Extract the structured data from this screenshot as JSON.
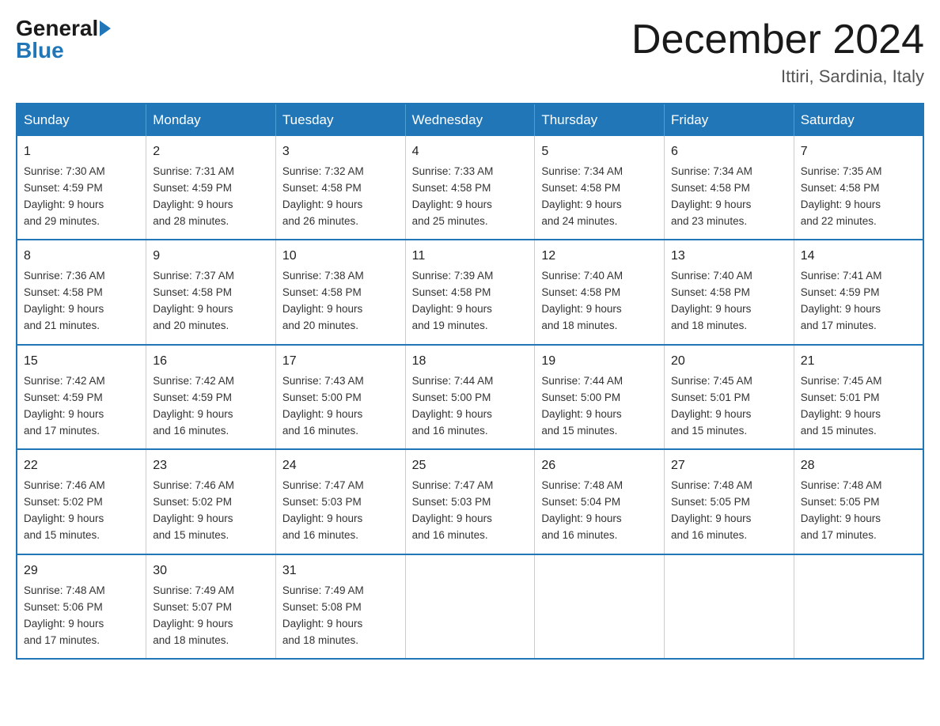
{
  "header": {
    "logo_general": "General",
    "logo_blue": "Blue",
    "month_year": "December 2024",
    "location": "Ittiri, Sardinia, Italy"
  },
  "days_of_week": [
    "Sunday",
    "Monday",
    "Tuesday",
    "Wednesday",
    "Thursday",
    "Friday",
    "Saturday"
  ],
  "weeks": [
    [
      {
        "day": "1",
        "sunrise": "7:30 AM",
        "sunset": "4:59 PM",
        "daylight": "9 hours and 29 minutes."
      },
      {
        "day": "2",
        "sunrise": "7:31 AM",
        "sunset": "4:59 PM",
        "daylight": "9 hours and 28 minutes."
      },
      {
        "day": "3",
        "sunrise": "7:32 AM",
        "sunset": "4:58 PM",
        "daylight": "9 hours and 26 minutes."
      },
      {
        "day": "4",
        "sunrise": "7:33 AM",
        "sunset": "4:58 PM",
        "daylight": "9 hours and 25 minutes."
      },
      {
        "day": "5",
        "sunrise": "7:34 AM",
        "sunset": "4:58 PM",
        "daylight": "9 hours and 24 minutes."
      },
      {
        "day": "6",
        "sunrise": "7:34 AM",
        "sunset": "4:58 PM",
        "daylight": "9 hours and 23 minutes."
      },
      {
        "day": "7",
        "sunrise": "7:35 AM",
        "sunset": "4:58 PM",
        "daylight": "9 hours and 22 minutes."
      }
    ],
    [
      {
        "day": "8",
        "sunrise": "7:36 AM",
        "sunset": "4:58 PM",
        "daylight": "9 hours and 21 minutes."
      },
      {
        "day": "9",
        "sunrise": "7:37 AM",
        "sunset": "4:58 PM",
        "daylight": "9 hours and 20 minutes."
      },
      {
        "day": "10",
        "sunrise": "7:38 AM",
        "sunset": "4:58 PM",
        "daylight": "9 hours and 20 minutes."
      },
      {
        "day": "11",
        "sunrise": "7:39 AM",
        "sunset": "4:58 PM",
        "daylight": "9 hours and 19 minutes."
      },
      {
        "day": "12",
        "sunrise": "7:40 AM",
        "sunset": "4:58 PM",
        "daylight": "9 hours and 18 minutes."
      },
      {
        "day": "13",
        "sunrise": "7:40 AM",
        "sunset": "4:58 PM",
        "daylight": "9 hours and 18 minutes."
      },
      {
        "day": "14",
        "sunrise": "7:41 AM",
        "sunset": "4:59 PM",
        "daylight": "9 hours and 17 minutes."
      }
    ],
    [
      {
        "day": "15",
        "sunrise": "7:42 AM",
        "sunset": "4:59 PM",
        "daylight": "9 hours and 17 minutes."
      },
      {
        "day": "16",
        "sunrise": "7:42 AM",
        "sunset": "4:59 PM",
        "daylight": "9 hours and 16 minutes."
      },
      {
        "day": "17",
        "sunrise": "7:43 AM",
        "sunset": "5:00 PM",
        "daylight": "9 hours and 16 minutes."
      },
      {
        "day": "18",
        "sunrise": "7:44 AM",
        "sunset": "5:00 PM",
        "daylight": "9 hours and 16 minutes."
      },
      {
        "day": "19",
        "sunrise": "7:44 AM",
        "sunset": "5:00 PM",
        "daylight": "9 hours and 15 minutes."
      },
      {
        "day": "20",
        "sunrise": "7:45 AM",
        "sunset": "5:01 PM",
        "daylight": "9 hours and 15 minutes."
      },
      {
        "day": "21",
        "sunrise": "7:45 AM",
        "sunset": "5:01 PM",
        "daylight": "9 hours and 15 minutes."
      }
    ],
    [
      {
        "day": "22",
        "sunrise": "7:46 AM",
        "sunset": "5:02 PM",
        "daylight": "9 hours and 15 minutes."
      },
      {
        "day": "23",
        "sunrise": "7:46 AM",
        "sunset": "5:02 PM",
        "daylight": "9 hours and 15 minutes."
      },
      {
        "day": "24",
        "sunrise": "7:47 AM",
        "sunset": "5:03 PM",
        "daylight": "9 hours and 16 minutes."
      },
      {
        "day": "25",
        "sunrise": "7:47 AM",
        "sunset": "5:03 PM",
        "daylight": "9 hours and 16 minutes."
      },
      {
        "day": "26",
        "sunrise": "7:48 AM",
        "sunset": "5:04 PM",
        "daylight": "9 hours and 16 minutes."
      },
      {
        "day": "27",
        "sunrise": "7:48 AM",
        "sunset": "5:05 PM",
        "daylight": "9 hours and 16 minutes."
      },
      {
        "day": "28",
        "sunrise": "7:48 AM",
        "sunset": "5:05 PM",
        "daylight": "9 hours and 17 minutes."
      }
    ],
    [
      {
        "day": "29",
        "sunrise": "7:48 AM",
        "sunset": "5:06 PM",
        "daylight": "9 hours and 17 minutes."
      },
      {
        "day": "30",
        "sunrise": "7:49 AM",
        "sunset": "5:07 PM",
        "daylight": "9 hours and 18 minutes."
      },
      {
        "day": "31",
        "sunrise": "7:49 AM",
        "sunset": "5:08 PM",
        "daylight": "9 hours and 18 minutes."
      },
      null,
      null,
      null,
      null
    ]
  ],
  "labels": {
    "sunrise": "Sunrise:",
    "sunset": "Sunset:",
    "daylight": "Daylight:"
  }
}
